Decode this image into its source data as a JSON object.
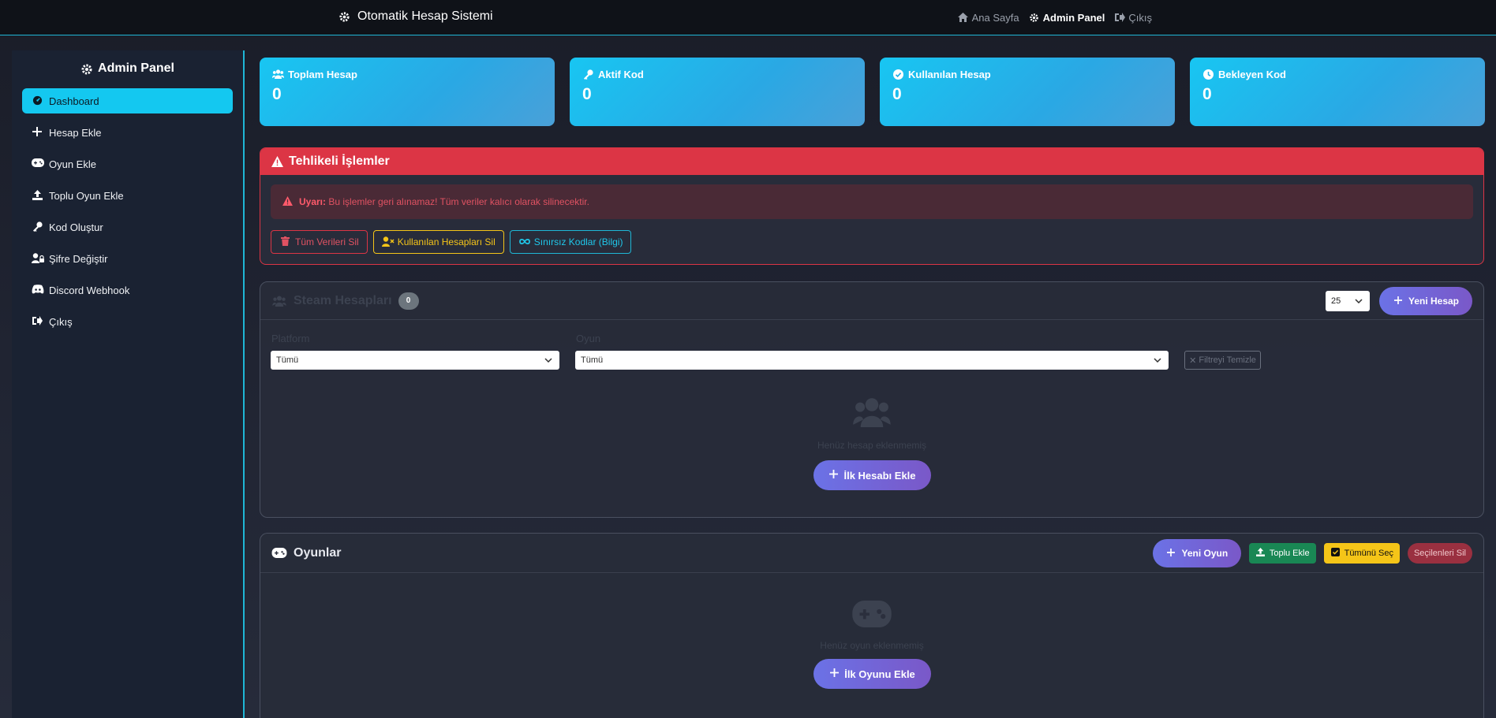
{
  "header": {
    "brand": "Otomatik Hesap Sistemi",
    "nav": [
      {
        "label": "Ana Sayfa",
        "icon": "home-icon"
      },
      {
        "label": "Admin Panel",
        "icon": "gear-icon"
      },
      {
        "label": "Çıkış",
        "icon": "sign-out-icon"
      }
    ]
  },
  "sidebar": {
    "title": "Admin Panel",
    "items": [
      {
        "label": "Dashboard",
        "icon": "dashboard-icon"
      },
      {
        "label": "Hesap Ekle",
        "icon": "plus-icon"
      },
      {
        "label": "Oyun Ekle",
        "icon": "gamepad-icon"
      },
      {
        "label": "Toplu Oyun Ekle",
        "icon": "upload-icon"
      },
      {
        "label": "Kod Oluştur",
        "icon": "key-icon"
      },
      {
        "label": "Şifre Değiştir",
        "icon": "user-lock-icon"
      },
      {
        "label": "Discord Webhook",
        "icon": "discord-icon"
      },
      {
        "label": "Çıkış",
        "icon": "sign-out-icon"
      }
    ]
  },
  "stats": [
    {
      "label": "Toplam Hesap",
      "value": "0",
      "icon": "users-icon"
    },
    {
      "label": "Aktif Kod",
      "value": "0",
      "icon": "key-icon"
    },
    {
      "label": "Kullanılan Hesap",
      "value": "0",
      "icon": "check-circle-icon"
    },
    {
      "label": "Bekleyen Kod",
      "value": "0",
      "icon": "clock-icon"
    }
  ],
  "danger": {
    "title": "Tehlikeli İşlemler",
    "warning_label": "Uyarı:",
    "warning_text": "Bu işlemler geri alınamaz! Tüm veriler kalıcı olarak silinecektir.",
    "buttons": [
      "Tüm Verileri Sil",
      "Kullanılan Hesapları Sil",
      "Sınırsız Kodlar (Bilgi)"
    ]
  },
  "accounts": {
    "title": "Steam Hesapları",
    "count": "0",
    "per_page": "25",
    "new_button": "Yeni Hesap",
    "platform_label": "Platform",
    "platform_value": "Tümü",
    "game_label": "Oyun",
    "game_value": "Tümü",
    "clear_filter": "Filtreyi Temizle",
    "empty_text": "Henüz hesap eklenmemiş",
    "first_button": "İlk Hesabı Ekle"
  },
  "games": {
    "title": "Oyunlar",
    "new_button": "Yeni Oyun",
    "bulk_button": "Toplu Ekle",
    "select_all": "Tümünü Seç",
    "delete_selected": "Seçilenleri Sil",
    "empty_text": "Henüz oyun eklenmemiş",
    "first_button": "İlk Oyunu Ekle"
  },
  "colors": {
    "accent": "#14c8f0",
    "danger": "#dc3545",
    "warning": "#f5c518",
    "success": "#198754",
    "gradient_start": "#6b72e6",
    "gradient_end": "#7a58c8"
  }
}
